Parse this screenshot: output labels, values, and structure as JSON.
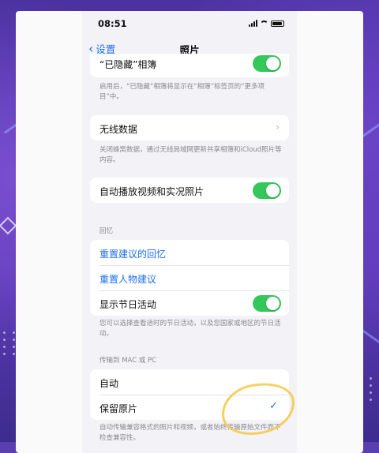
{
  "status_bar": {
    "time": "08:51"
  },
  "nav": {
    "back_label": "设置",
    "title": "照片"
  },
  "hidden_album": {
    "label": "“已隐藏”相簿",
    "footer": "启用后，“已隐藏”相簿将显示在“相簿”标签页的“更多项目”中。"
  },
  "wireless": {
    "label": "无线数据",
    "footer": "关闭蜂窝数据，通过无线局域网更新共享相簿和iCloud照片等内容。"
  },
  "autoplay": {
    "label": "自动播放视频和实况照片"
  },
  "memories": {
    "header": "回忆",
    "reset_memories": "重置建议的回忆",
    "reset_people": "重置人物建议",
    "holiday_label": "显示节日活动",
    "footer": "您可以选择查看适时的节日活动，以及您国家或地区的节日活动。"
  },
  "transfer": {
    "header": "传输到 MAC 或 PC",
    "auto_label": "自动",
    "original_label": "保留原片",
    "footer": "自动传输兼容格式的照片和视频，或者始终传输原始文件而不检查兼容性。"
  },
  "colors": {
    "accent": "#1f6fea",
    "toggle_on": "#34c759",
    "highlight": "#f5c846"
  },
  "toggles": {
    "hidden_album": true,
    "autoplay": true,
    "holiday": true
  },
  "selected_transfer": "original"
}
